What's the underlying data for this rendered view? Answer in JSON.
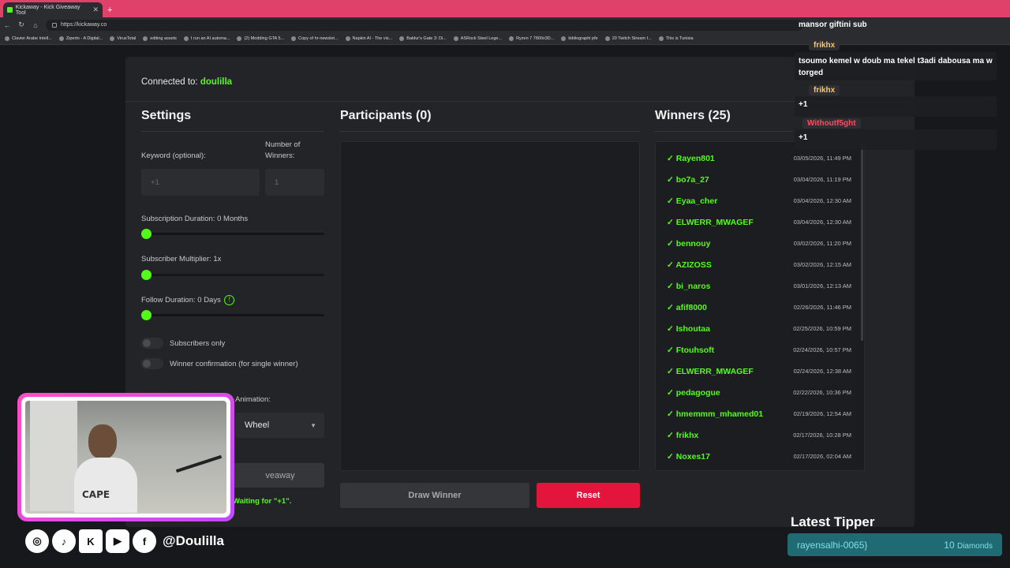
{
  "browser": {
    "tab_title": "Kickaway - Kick Giveaway Tool",
    "tab_close": "✕",
    "new_tab": "+",
    "url": "https://kickaway.co",
    "bookmarks": [
      "Clavier Arabe Intell...",
      "Ziperto - A Digital...",
      "VirusTotal",
      "editing assets",
      "I run an AI automa...",
      "(2) Modding GTA 5...",
      "Copy of hr-newslet...",
      "Napkin AI - The vis...",
      "Baldur's Gate 3: Di...",
      "ASRock Steel Lege...",
      "Ryzen 7 7800x3D...",
      "bibliographi pfe",
      "20 Twitch Stream I...",
      "This is Tunisia"
    ]
  },
  "connection": {
    "prefix": "Connected to:",
    "channel": "doulilla"
  },
  "settings": {
    "title": "Settings",
    "keyword_label": "Keyword (optional):",
    "keyword_placeholder": "+1",
    "winners_label_1": "Number of",
    "winners_label_2": "Winners:",
    "winners_placeholder": "1",
    "sub_duration_label": "Subscription Duration: 0 Months",
    "sub_multiplier_label": "Subscriber Multiplier: 1x",
    "follow_label": "Follow Duration:  0  Days",
    "info_glyph": "!",
    "subscribers_only": "Subscribers only",
    "winner_confirmation": "Winner confirmation (for single winner)",
    "animation_label": "Animation:",
    "animation_value": "Wheel",
    "start_button": "veaway",
    "waiting_text": "t! Waiting for \"+1\"."
  },
  "participants": {
    "title": "Participants (0)",
    "draw_button": "Draw Winner",
    "reset_button": "Reset"
  },
  "winners": {
    "title": "Winners (25)",
    "check": "✓",
    "list": [
      {
        "name": "Rayen801",
        "date": "03/05/2026, 11:49 PM"
      },
      {
        "name": "bo7a_27",
        "date": "03/04/2026, 11:19 PM"
      },
      {
        "name": "Eyaa_cher",
        "date": "03/04/2026, 12:30 AM"
      },
      {
        "name": "ELWERR_MWAGEF",
        "date": "03/04/2026, 12:30 AM"
      },
      {
        "name": "bennouy",
        "date": "03/02/2026, 11:20 PM"
      },
      {
        "name": "AZIZOSS",
        "date": "03/02/2026, 12:15 AM"
      },
      {
        "name": "bi_naros",
        "date": "03/01/2026, 12:13 AM"
      },
      {
        "name": "afif8000",
        "date": "02/26/2026, 11:46 PM"
      },
      {
        "name": "Ishoutaa",
        "date": "02/25/2026, 10:59 PM"
      },
      {
        "name": "Ftouhsoft",
        "date": "02/24/2026, 10:57 PM"
      },
      {
        "name": "ELWERR_MWAGEF",
        "date": "02/24/2026, 12:38 AM"
      },
      {
        "name": "pedagogue",
        "date": "02/22/2026, 10:36 PM"
      },
      {
        "name": "hmemmm_mhamed01",
        "date": "02/19/2026, 12:54 AM"
      },
      {
        "name": "frikhx",
        "date": "02/17/2026, 10:28 PM"
      },
      {
        "name": "Noxes17",
        "date": "02/17/2026, 02:04 AM"
      }
    ]
  },
  "chat": {
    "messages": [
      {
        "user": "",
        "text": "mansor giftini sub"
      },
      {
        "user": "frikhx",
        "text": "tsoumo kemel w doub ma tekel t3adi dabousa ma w torged"
      },
      {
        "user": "frikhx",
        "text": "+1"
      },
      {
        "user": "Withoutf5ght",
        "text": "+1"
      }
    ]
  },
  "webcam": {
    "brand_text": "CAPE"
  },
  "socials": {
    "icons": [
      {
        "name": "instagram-icon",
        "glyph": "◎"
      },
      {
        "name": "tiktok-icon",
        "glyph": "♪"
      },
      {
        "name": "kick-icon",
        "glyph": "K"
      },
      {
        "name": "youtube-icon",
        "glyph": "▶"
      },
      {
        "name": "facebook-icon",
        "glyph": "f"
      }
    ],
    "handle": "@Doulilla"
  },
  "tipper": {
    "title": "Latest Tipper",
    "name": "rayensalhi-0065}",
    "amount": "10",
    "unit": "Diamonds"
  },
  "colors": {
    "accent": "#53fc18",
    "danger": "#e4153d",
    "panel": "#232428",
    "background": "#17181b"
  }
}
